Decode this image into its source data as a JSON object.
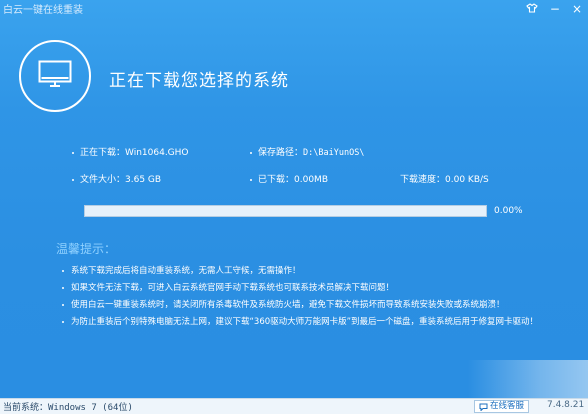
{
  "window": {
    "title": "白云一键在线重装",
    "controls": {
      "skin_icon": "skin-icon",
      "minimize": "−",
      "close": "×"
    }
  },
  "header": {
    "icon": "monitor-icon",
    "title": "正在下载您选择的系统"
  },
  "download": {
    "current_label": "正在下载：",
    "current_value": "Win1064.GHO",
    "path_label": "保存路径：",
    "path_value": "D:\\BaiYunOS\\",
    "size_label": "文件大小：",
    "size_value": "3.65 GB",
    "downloaded_label": "已下载：",
    "downloaded_value": "0.00MB",
    "speed_label": "下载速度：",
    "speed_value": "0.00 KB/S",
    "progress_percent": 0,
    "progress_text": "0.00%"
  },
  "tips": {
    "title": "温馨提示：",
    "items": [
      "系统下载完成后将自动重装系统，无需人工守候，无需操作！",
      "如果文件无法下载，可进入白云系统官网手动下载系统也可联系技术员解决下载问题！",
      "使用白云一键重装系统时，请关闭所有杀毒软件及系统防火墙，避免下载文件损坏而导致系统安装失败或系统崩溃！",
      "为防止重装后个别特殊电脑无法上网，建议下载“360驱动大师万能网卡版”到最后一个磁盘，重装系统后用于修复网卡驱动！"
    ]
  },
  "statusbar": {
    "system_text": "当前系统：Windows 7 (64位)",
    "service_label": "在线客服",
    "version": "7.4.8.21"
  },
  "colors": {
    "background": "#2f95e6",
    "tips_title": "#8fd1ff",
    "progress_track": "#e6f1fb"
  }
}
